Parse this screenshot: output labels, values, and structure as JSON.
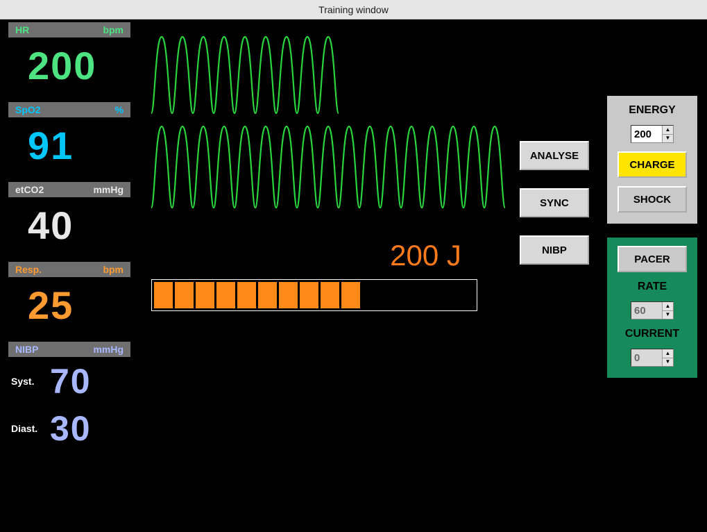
{
  "window": {
    "title": "Training window"
  },
  "vitals": {
    "hr": {
      "label": "HR",
      "unit": "bpm",
      "value": "200"
    },
    "spo2": {
      "label": "SpO2",
      "unit": "%",
      "value": "91"
    },
    "etco2": {
      "label": "etCO2",
      "unit": "mmHg",
      "value": "40"
    },
    "resp": {
      "label": "Resp.",
      "unit": "bpm",
      "value": "25"
    },
    "nibp": {
      "label": "NIBP",
      "unit": "mmHg",
      "systolic": {
        "label": "Syst.",
        "value": "70"
      },
      "diastolic": {
        "label": "Diast.",
        "value": "30"
      }
    }
  },
  "buttons": {
    "analyse": "ANALYSE",
    "sync": "SYNC",
    "nibp": "NIBP"
  },
  "energy_panel": {
    "title": "ENERGY",
    "value": "200",
    "charge_btn": "CHARGE",
    "shock_btn": "SHOCK"
  },
  "pacer_panel": {
    "pacer_btn": "PACER",
    "rate_label": "RATE",
    "rate_value": "60",
    "current_label": "CURRENT",
    "current_value": "0"
  },
  "charge": {
    "display": "200 J",
    "segments_filled": 10,
    "segments_total": 16
  },
  "colors": {
    "hr": "#4de383",
    "spo2": "#00c8ff",
    "etco2": "#e8e8e8",
    "resp": "#ff9a30",
    "nibp": "#a8b7ff",
    "waveform": "#29d43d",
    "charge_bar": "#ff8a1a",
    "charge_text": "#ff7a1a"
  }
}
